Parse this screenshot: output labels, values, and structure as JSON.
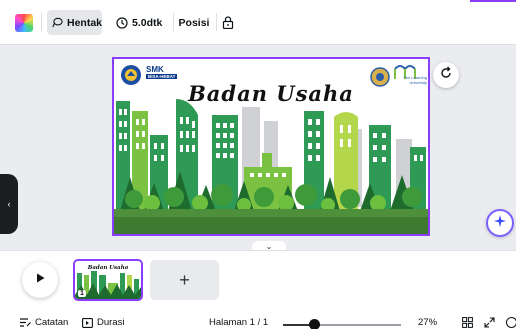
{
  "toolbar": {
    "hentak_label": "Hentak",
    "duration_label": "5.0dtk",
    "posisi_label": "Posisi"
  },
  "slide": {
    "title": "Badan Usaha",
    "school_logo_text": "SMK",
    "school_logo_sub": "BISA-HEBAT",
    "university_text": "The Learning University"
  },
  "pages": {
    "thumb_title": "Badan Usaha",
    "thumb_number": "1",
    "add_label": "+"
  },
  "status": {
    "catatan_label": "Catatan",
    "durasi_label": "Durasi",
    "page_indicator": "Halaman 1 / 1",
    "zoom_percent": "27%",
    "zoom_level": 0.27
  },
  "colors": {
    "accent": "#8b3dff",
    "building_green": "#2f9a55",
    "light_green": "#7cc242",
    "tree_dark": "#1e6b2e",
    "ground": "#4d8f3a"
  }
}
